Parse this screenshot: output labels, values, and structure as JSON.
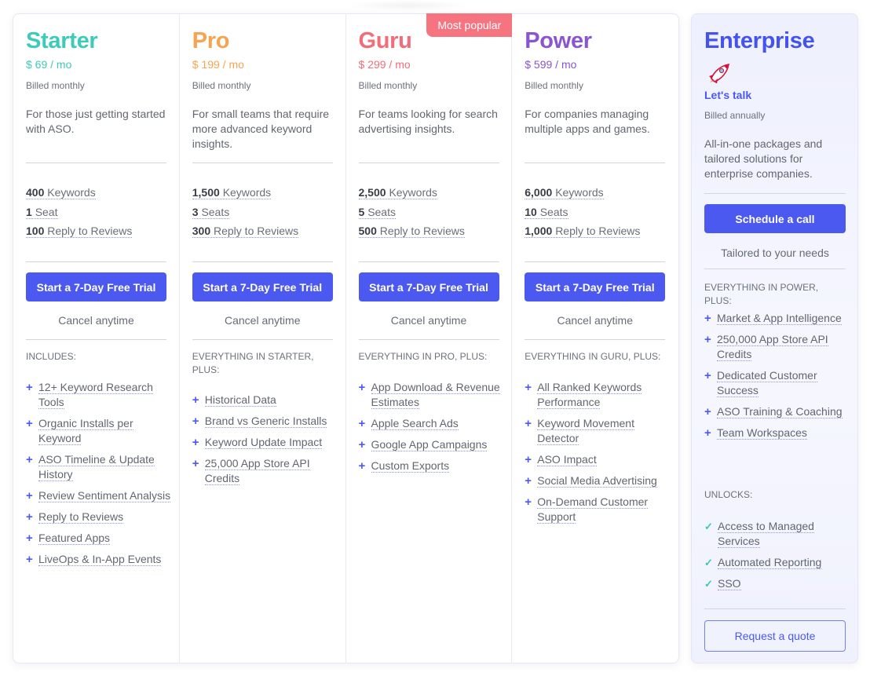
{
  "colors": {
    "starter": "#3ccbb9",
    "pro": "#f8a34f",
    "guru": "#f36c7a",
    "power": "#8a55cf",
    "enterprise": "#4453ee",
    "accent": "#4b59f0",
    "check": "#3cc6b4",
    "badge": "#f57480"
  },
  "plans": [
    {
      "name": "Starter",
      "price": "$ 69 / mo",
      "billing": "Billed monthly",
      "description": "For those just getting started with ASO.",
      "quotas": [
        {
          "value": "400",
          "label": "Keywords"
        },
        {
          "value": "1",
          "label": "Seat"
        },
        {
          "value": "100",
          "label": "Reply to Reviews"
        }
      ],
      "cta": "Start a 7-Day Free Trial",
      "cancel": "Cancel anytime",
      "includes_title": "INCLUDES:",
      "features": [
        "12+ Keyword Research Tools",
        "Organic Installs per Keyword",
        "ASO Timeline & Update History",
        "Review Sentiment Analysis",
        "Reply to Reviews",
        "Featured Apps",
        "LiveOps & In-App Events"
      ]
    },
    {
      "name": "Pro",
      "price": "$ 199 / mo",
      "billing": "Billed monthly",
      "description": "For small teams that require more advanced keyword insights.",
      "quotas": [
        {
          "value": "1,500",
          "label": "Keywords"
        },
        {
          "value": "3",
          "label": "Seats"
        },
        {
          "value": "300",
          "label": "Reply to Reviews"
        }
      ],
      "cta": "Start a 7-Day Free Trial",
      "cancel": "Cancel anytime",
      "includes_title": "EVERYTHING IN STARTER, PLUS:",
      "features": [
        "Historical Data",
        "Brand vs Generic Installs",
        "Keyword Update Impact",
        "25,000 App Store API Credits"
      ]
    },
    {
      "name": "Guru",
      "badge": "Most popular",
      "price": "$ 299 / mo",
      "billing": "Billed monthly",
      "description": "For teams looking for search advertising insights.",
      "quotas": [
        {
          "value": "2,500",
          "label": "Keywords"
        },
        {
          "value": "5",
          "label": "Seats"
        },
        {
          "value": "500",
          "label": "Reply to Reviews"
        }
      ],
      "cta": "Start a 7-Day Free Trial",
      "cancel": "Cancel anytime",
      "includes_title": "EVERYTHING IN PRO, PLUS:",
      "features": [
        "App Download & Revenue Estimates",
        "Apple Search Ads",
        "Google App Campaigns",
        "Custom Exports"
      ]
    },
    {
      "name": "Power",
      "price": "$ 599 / mo",
      "billing": "Billed monthly",
      "description": "For companies managing multiple apps and games.",
      "quotas": [
        {
          "value": "6,000",
          "label": "Keywords"
        },
        {
          "value": "10",
          "label": "Seats"
        },
        {
          "value": "1,000",
          "label": "Reply to Reviews"
        }
      ],
      "cta": "Start a 7-Day Free Trial",
      "cancel": "Cancel anytime",
      "includes_title": "EVERYTHING IN GURU, PLUS:",
      "features": [
        "All Ranked Keywords Performance",
        "Keyword Movement Detector",
        "ASO Impact",
        "Social Media Advertising",
        "On-Demand Customer Support"
      ]
    }
  ],
  "enterprise": {
    "name": "Enterprise",
    "icon": "rocket-icon",
    "price": "Let's talk",
    "billing": "Billed annually",
    "description": "All-in-one packages and tailored solutions for enterprise companies.",
    "cta": "Schedule a call",
    "note": "Tailored to your needs",
    "includes_title": "EVERYTHING IN POWER, PLUS:",
    "features": [
      "Market & App Intelligence",
      "250,000 App Store API Credits",
      "Dedicated Customer Success",
      "ASO Training & Coaching",
      "Team Workspaces"
    ],
    "unlocks_title": "UNLOCKS:",
    "unlocks": [
      "Access to Managed Services",
      "Automated Reporting",
      "SSO"
    ],
    "quote_button": "Request a quote"
  }
}
